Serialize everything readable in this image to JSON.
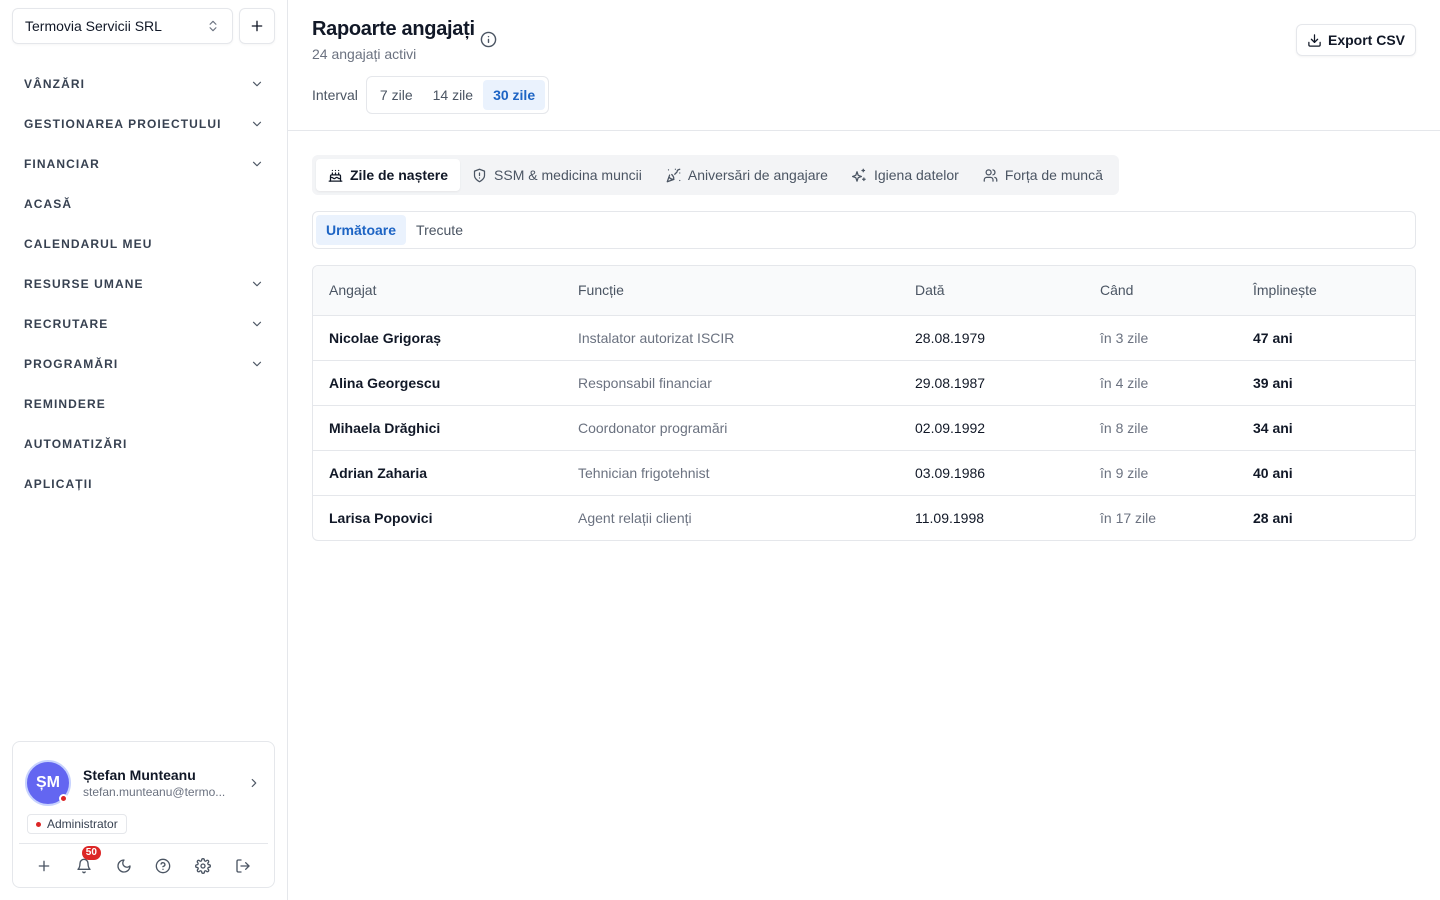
{
  "sidebar": {
    "org_name": "Termovia Servicii SRL",
    "nav": [
      {
        "label": "VÂNZĂRI",
        "chevron": true
      },
      {
        "label": "GESTIONAREA PROIECTULUI",
        "chevron": true
      },
      {
        "label": "FINANCIAR",
        "chevron": true
      },
      {
        "label": "ACASĂ",
        "chevron": false
      },
      {
        "label": "CALENDARUL MEU",
        "chevron": false
      },
      {
        "label": "RESURSE UMANE",
        "chevron": true
      },
      {
        "label": "RECRUTARE",
        "chevron": true
      },
      {
        "label": "PROGRAMĂRI",
        "chevron": true
      },
      {
        "label": "REMINDERE",
        "chevron": false
      },
      {
        "label": "AUTOMATIZĂRI",
        "chevron": false
      },
      {
        "label": "APLICAȚII",
        "chevron": false
      }
    ],
    "user": {
      "initials": "ȘM",
      "name": "Ștefan Munteanu",
      "email": "stefan.munteanu@termo...",
      "role": "Administrator",
      "notifications": "50"
    }
  },
  "header": {
    "title": "Rapoarte angajați",
    "subtitle": "24 angajați activi",
    "interval_label": "Interval",
    "intervals": [
      "7 zile",
      "14 zile",
      "30 zile"
    ],
    "active_interval": "30 zile",
    "export_label": "Export CSV"
  },
  "tabs": [
    {
      "label": "Zile de naștere",
      "icon": "cake-icon"
    },
    {
      "label": "SSM & medicina muncii",
      "icon": "shield-icon"
    },
    {
      "label": "Aniversări de angajare",
      "icon": "party-popper-icon"
    },
    {
      "label": "Igiena datelor",
      "icon": "sparkles-icon"
    },
    {
      "label": "Forța de muncă",
      "icon": "users-icon"
    }
  ],
  "active_tab": "Zile de naștere",
  "subtabs": [
    "Următoare",
    "Trecute"
  ],
  "active_subtab": "Următoare",
  "table": {
    "columns": [
      "Angajat",
      "Funcție",
      "Dată",
      "Când",
      "Împlinește"
    ],
    "rows": [
      [
        "Nicolae Grigoraș",
        "Instalator autorizat ISCIR",
        "28.08.1979",
        "în 3 zile",
        "47 ani"
      ],
      [
        "Alina Georgescu",
        "Responsabil financiar",
        "29.08.1987",
        "în 4 zile",
        "39 ani"
      ],
      [
        "Mihaela Drăghici",
        "Coordonator programări",
        "02.09.1992",
        "în 8 zile",
        "34 ani"
      ],
      [
        "Adrian Zaharia",
        "Tehnician frigotehnist",
        "03.09.1986",
        "în 9 zile",
        "40 ani"
      ],
      [
        "Larisa Popovici",
        "Agent relații clienți",
        "11.09.1998",
        "în 17 zile",
        "28 ani"
      ]
    ]
  },
  "colors": {
    "accent": "#1d64c4",
    "accent_bg": "#eaf2fd",
    "avatar": "#6366f1",
    "danger": "#dc2626"
  }
}
